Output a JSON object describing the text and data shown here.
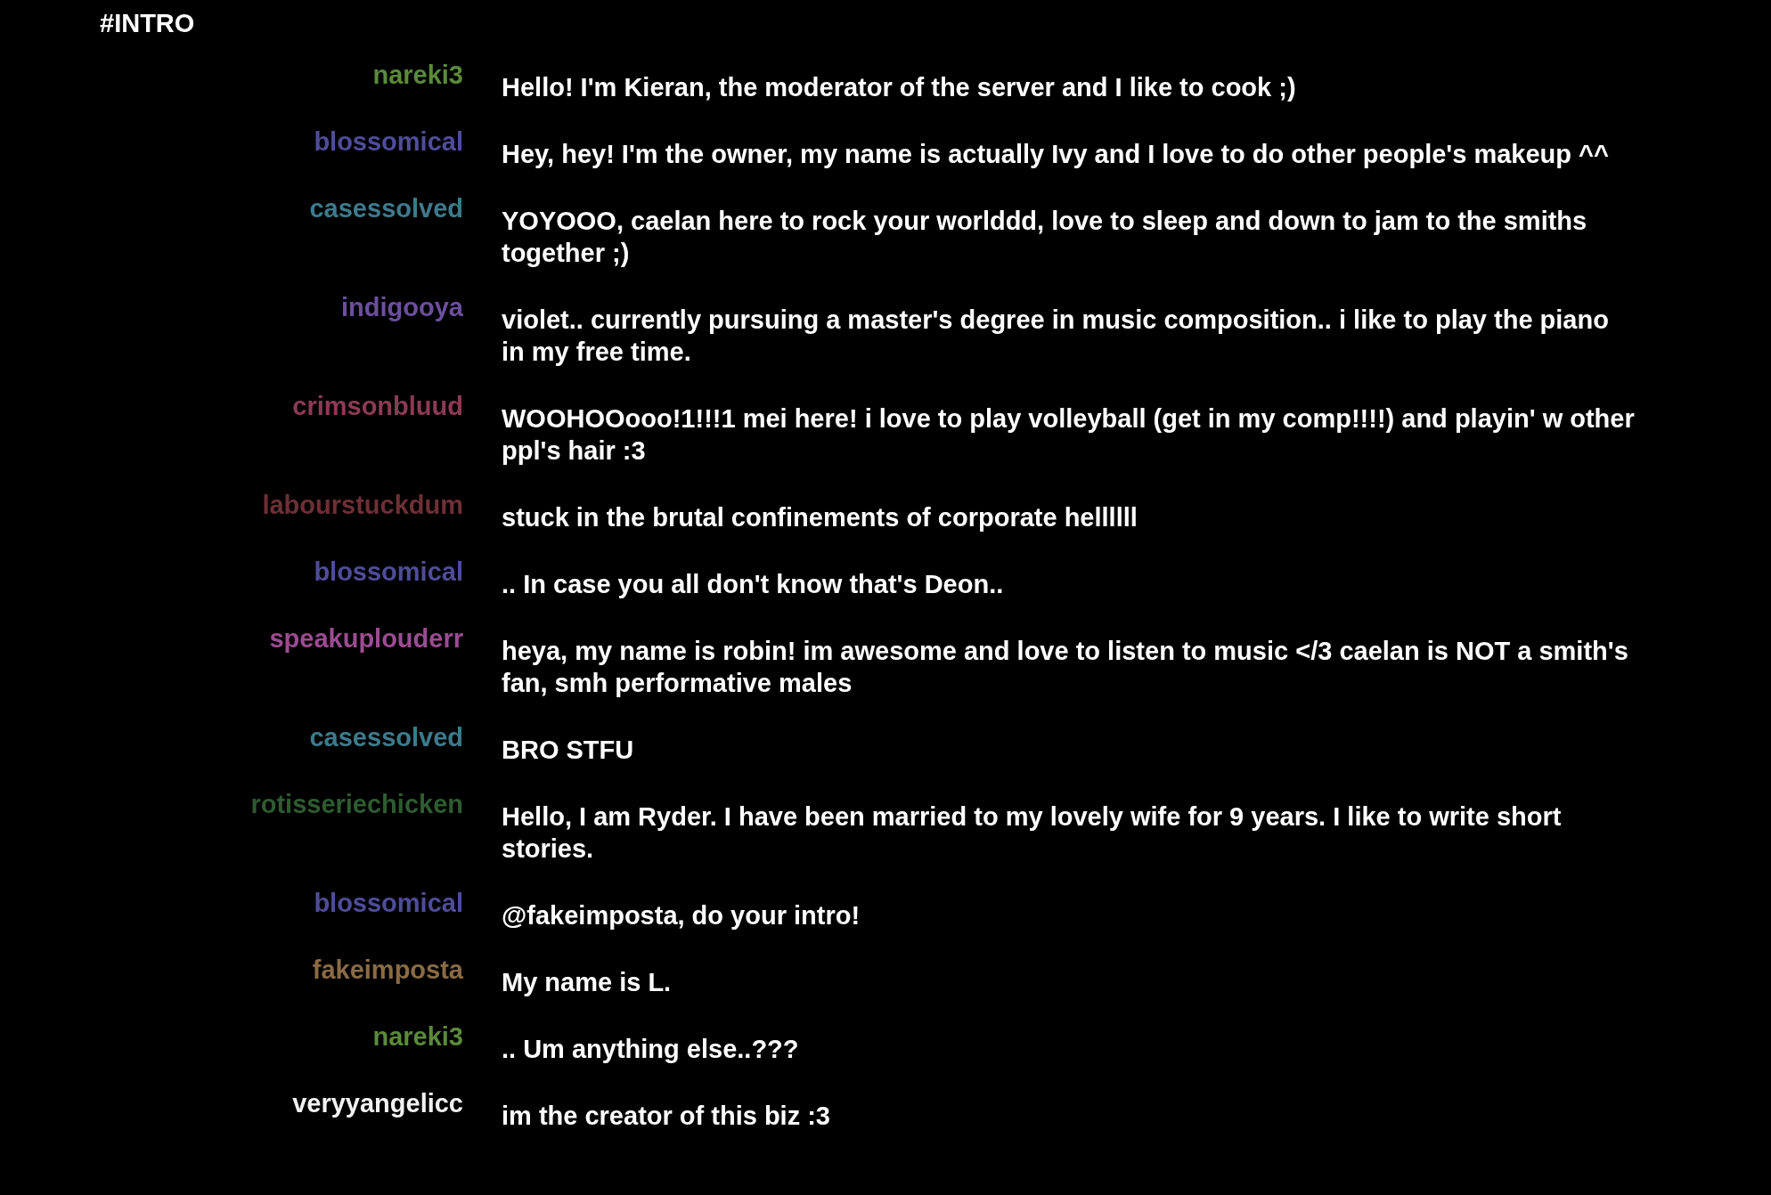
{
  "channel": {
    "title": "#INTRO"
  },
  "messages": [
    {
      "author": "nareki3",
      "color": "#5b8a3a",
      "text": "Hello! I'm Kieran, the moderator of the server and I like to cook ;)"
    },
    {
      "author": "blossomical",
      "color": "#4f4c99",
      "text": "Hey, hey! I'm the owner, my name is actually Ivy and I love to do other people's makeup ^^"
    },
    {
      "author": "casessolved",
      "color": "#3e7a8c",
      "text": "YOYOOO, caelan here to rock your worlddd, love to sleep and down to jam to the smiths together ;)"
    },
    {
      "author": "indigooya",
      "color": "#6b4f9e",
      "text": "violet.. currently pursuing a master's degree in music composition.. i like to play the piano in my free time."
    },
    {
      "author": "crimsonbluud",
      "color": "#8c3b55",
      "text": "WOOHOOooo!1!!!1 mei here! i love to play volleyball (get in my comp!!!!) and playin' w other ppl's hair :3"
    },
    {
      "author": "labourstuckdum",
      "color": "#6e2f36",
      "text": "stuck in the brutal confinements of corporate hellllll"
    },
    {
      "author": "blossomical",
      "color": "#4f4c99",
      "text": ".. In case you all don't know that's Deon.."
    },
    {
      "author": "speakuplouderr",
      "color": "#9b4c91",
      "text": "heya, my name is robin! im awesome and love to listen to music </3 caelan is NOT a smith's fan, smh performative males"
    },
    {
      "author": "casessolved",
      "color": "#3e7a8c",
      "text": "BRO STFU"
    },
    {
      "author": "rotisseriechicken",
      "color": "#2f5b31",
      "text": "Hello, I am Ryder. I have been married to my lovely wife for 9 years. I like to write short stories."
    },
    {
      "author": "blossomical",
      "color": "#4f4c99",
      "text": "@fakeimposta, do your intro!"
    },
    {
      "author": "fakeimposta",
      "color": "#8a6b45",
      "text": "My name is L."
    },
    {
      "author": "nareki3",
      "color": "#5b8a3a",
      "text": ".. Um anything else..???"
    },
    {
      "author": "veryyangelicc",
      "color": "#f2f2f2",
      "text": "im the creator of this biz :3"
    }
  ]
}
